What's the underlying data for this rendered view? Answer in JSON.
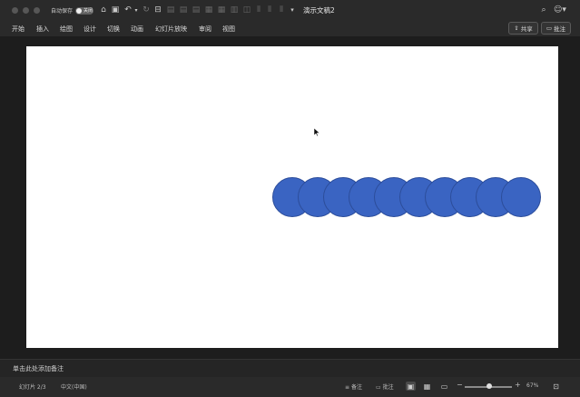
{
  "titlebar": {
    "autosave_label": "自动保存",
    "autosave_state": "关闭",
    "doc_title": "演示文稿2",
    "icons": [
      "home-icon",
      "save-icon",
      "undo-icon",
      "redo-icon",
      "format-icon",
      "search-icon",
      "account-icon"
    ]
  },
  "ribbon": {
    "tabs": [
      "开始",
      "插入",
      "绘图",
      "设计",
      "切换",
      "动画",
      "幻灯片放映",
      "审阅",
      "视图"
    ],
    "share_label": "共享",
    "comment_label": "批注"
  },
  "slide": {
    "background": "#ffffff",
    "circle_color": "#3a64c2",
    "circle_count": 10
  },
  "notes": {
    "placeholder": "单击此处添加备注"
  },
  "statusbar": {
    "slide_indicator": "幻灯片 2/3",
    "language": "中文(中国)",
    "notes_label": "备注",
    "comments_label": "批注",
    "zoom_minus": "−",
    "zoom_plus": "+",
    "zoom_value": "67%"
  }
}
